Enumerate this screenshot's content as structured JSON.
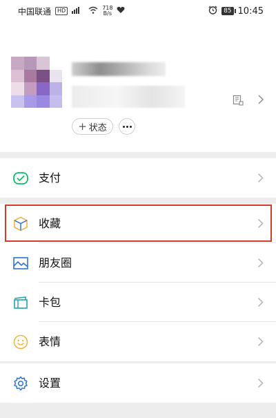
{
  "statusbar": {
    "carrier": "中国联通",
    "hd": "HD",
    "signal": "⁴⁶",
    "speed_value": "718",
    "speed_unit": "B/s",
    "battery": "85",
    "time": "10:45"
  },
  "profile": {
    "status_plus": "+",
    "status_label": "状态"
  },
  "menu": {
    "pay": "支付",
    "favorites": "收藏",
    "moments": "朋友圈",
    "cards": "卡包",
    "stickers": "表情",
    "settings": "设置"
  },
  "colors": {
    "accent_green": "#07c160",
    "favorites_yellow": "#f2b33d",
    "moments_blue": "#2b73d8",
    "cards_teal": "#1fa3b3",
    "highlight_red": "#d23a2a"
  }
}
